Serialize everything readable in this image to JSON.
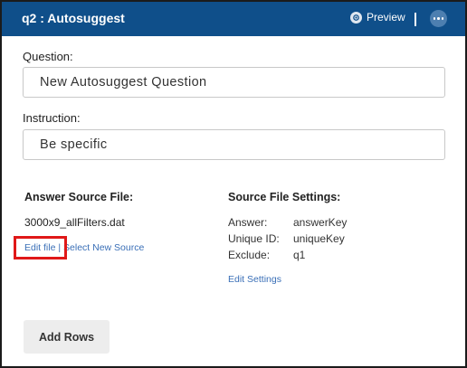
{
  "header": {
    "title": "q2 : Autosuggest",
    "preview_label": "Preview",
    "preview_icon": "eye-icon",
    "more_icon": "ellipsis-icon",
    "background_color": "#0f4f8a"
  },
  "question": {
    "label": "Question:",
    "value": "New Autosuggest Question"
  },
  "instruction": {
    "label": "Instruction:",
    "value": "Be specific"
  },
  "answer_source": {
    "heading": "Answer Source File:",
    "file_name": "3000x9_allFilters.dat",
    "edit_file_label": "Edit file",
    "separator": "|",
    "select_new_source_label": "Select New Source"
  },
  "source_settings": {
    "heading": "Source File Settings:",
    "rows": [
      {
        "key": "Answer:",
        "value": "answerKey"
      },
      {
        "key": "Unique ID:",
        "value": "uniqueKey"
      },
      {
        "key": "Exclude:",
        "value": "q1"
      }
    ],
    "edit_settings_label": "Edit Settings"
  },
  "actions": {
    "add_rows_label": "Add Rows"
  },
  "colors": {
    "link": "#3a6fb7",
    "highlight": "#e01818"
  }
}
